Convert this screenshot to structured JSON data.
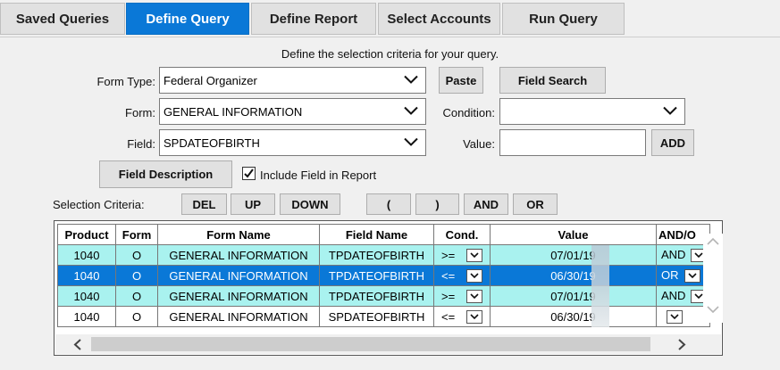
{
  "tabs": [
    {
      "label": "Saved Queries",
      "active": false
    },
    {
      "label": "Define Query",
      "active": true
    },
    {
      "label": "Define Report",
      "active": false
    },
    {
      "label": "Select Accounts",
      "active": false
    },
    {
      "label": "Run Query",
      "active": false
    }
  ],
  "intro": "Define the selection criteria for your query.",
  "form": {
    "form_type_label": "Form Type:",
    "form_type_value": "Federal Organizer",
    "form_label": "Form:",
    "form_value": "GENERAL INFORMATION",
    "field_label": "Field:",
    "field_value": "SPDATEOFBIRTH",
    "condition_label": "Condition:",
    "condition_value": "",
    "value_label": "Value:",
    "value_value": "",
    "paste_button": "Paste",
    "field_search_button": "Field Search",
    "add_button": "ADD",
    "field_description_button": "Field Description",
    "include_field_label": "Include Field in Report",
    "include_field_checked": true
  },
  "criteria": {
    "label": "Selection Criteria:",
    "buttons": {
      "del": "DEL",
      "up": "UP",
      "down": "DOWN",
      "open_paren": "(",
      "close_paren": ")",
      "and": "AND",
      "or": "OR"
    }
  },
  "grid": {
    "headers": {
      "product": "Product",
      "form": "Form",
      "form_name": "Form Name",
      "field_name": "Field Name",
      "cond": "Cond.",
      "value": "Value",
      "andor": "AND/O"
    },
    "rows": [
      {
        "product": "1040",
        "form": "O",
        "form_name": "GENERAL INFORMATION",
        "field_name": "TPDATEOFBIRTH",
        "cond": ">=",
        "value": "07/01/19",
        "andor": "AND",
        "style": "cyan"
      },
      {
        "product": "1040",
        "form": "O",
        "form_name": "GENERAL INFORMATION",
        "field_name": "TPDATEOFBIRTH",
        "cond": "<=",
        "value": "06/30/19",
        "andor": "OR",
        "style": "sel"
      },
      {
        "product": "1040",
        "form": "O",
        "form_name": "GENERAL INFORMATION",
        "field_name": "TPDATEOFBIRTH",
        "cond": ">=",
        "value": "07/01/19",
        "andor": "AND",
        "style": "cyan"
      },
      {
        "product": "1040",
        "form": "O",
        "form_name": "GENERAL INFORMATION",
        "field_name": "SPDATEOFBIRTH",
        "cond": "<=",
        "value": "06/30/19",
        "andor": "",
        "style": "white"
      }
    ]
  },
  "colors": {
    "accent": "#0a78d7",
    "row_highlight": "#a9f2ef",
    "panel": "#f0f0f0"
  }
}
